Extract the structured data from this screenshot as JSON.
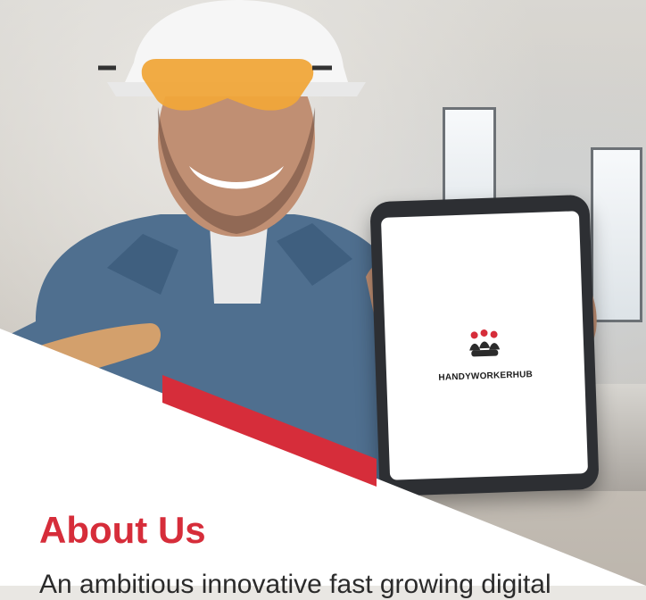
{
  "page": {
    "title": "About Us",
    "body_text_partial": "An ambitious innovative fast growing digital"
  },
  "tablet": {
    "logo_text": "HANDYWORKERHUB"
  },
  "colors": {
    "accent_red": "#d62d3a",
    "title_red": "#d62d3a"
  },
  "icons": {
    "logo": "handyworkerhub-logo-icon"
  }
}
